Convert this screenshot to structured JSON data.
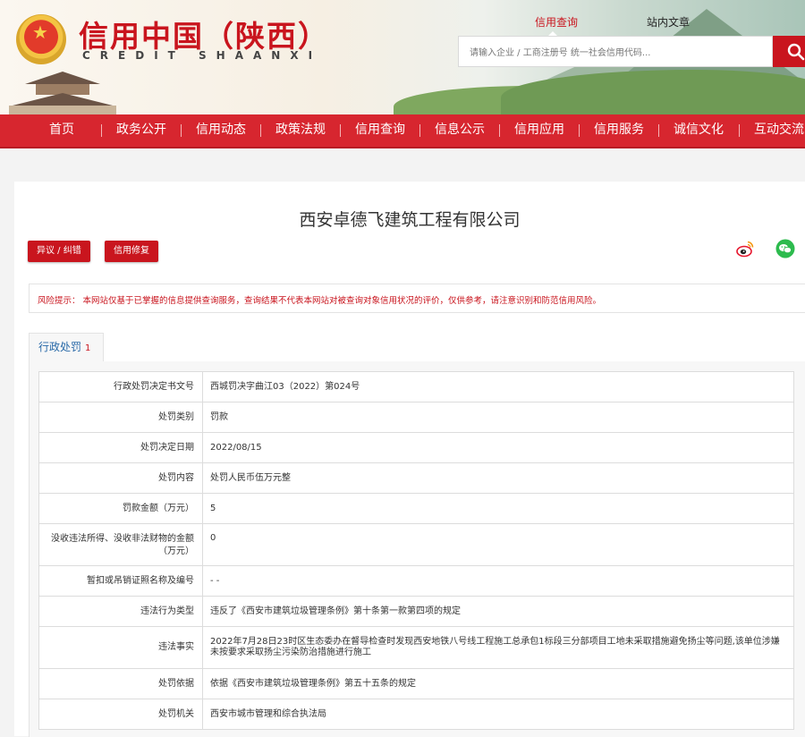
{
  "header": {
    "title_cn": "信用中国（陕西）",
    "title_en": "CREDIT SHAANXI",
    "tabs": [
      "信用查询",
      "站内文章"
    ],
    "search_placeholder": "请输入企业 / 工商注册号 统一社会信用代码...",
    "search_icon": "search-icon",
    "emblem_icon": "national-emblem-icon"
  },
  "nav": {
    "items": [
      "首页",
      "政务公开",
      "信用动态",
      "政策法规",
      "信用查询",
      "信息公示",
      "信用应用",
      "信用服务",
      "诚信文化",
      "互动交流"
    ]
  },
  "company": {
    "name": "西安卓德飞建筑工程有限公司",
    "objection_label": "异议 / 纠错",
    "repair_label": "信用修复",
    "share_icons": [
      "weibo-icon",
      "wechat-icon"
    ]
  },
  "notice": "风险提示：  本网站仅基于已掌握的信息提供查询服务，查询结果不代表本网站对被查询对象信用状况的评价，仅供参考，请注意识别和防范信用风险。",
  "tab": {
    "label": "行政处罚",
    "count": "1"
  },
  "records": [
    {
      "label": "行政处罚决定书文号",
      "value": "西城罚决字曲江03（2022）第024号"
    },
    {
      "label": "处罚类别",
      "value": "罚款"
    },
    {
      "label": "处罚决定日期",
      "value": "2022/08/15"
    },
    {
      "label": "处罚内容",
      "value": "处罚人民币伍万元整"
    },
    {
      "label": "罚款金额（万元）",
      "value": "5"
    },
    {
      "label": "没收违法所得、没收非法财物的金额（万元）",
      "value": "0"
    },
    {
      "label": "暂扣或吊销证照名称及编号",
      "value": "- -"
    },
    {
      "label": "违法行为类型",
      "value": "违反了《西安市建筑垃圾管理条例》第十条第一款第四项的规定"
    },
    {
      "label": "违法事实",
      "value": "2022年7月28日23时区生态委办在督导检查时发现西安地铁八号线工程施工总承包1标段三分部项目工地未采取措施避免扬尘等问题,该单位涉嫌未按要求采取扬尘污染防治措施进行施工"
    },
    {
      "label": "处罚依据",
      "value": "依据《西安市建筑垃圾管理条例》第五十五条的规定"
    },
    {
      "label": "处罚机关",
      "value": "西安市城市管理和综合执法局"
    }
  ]
}
